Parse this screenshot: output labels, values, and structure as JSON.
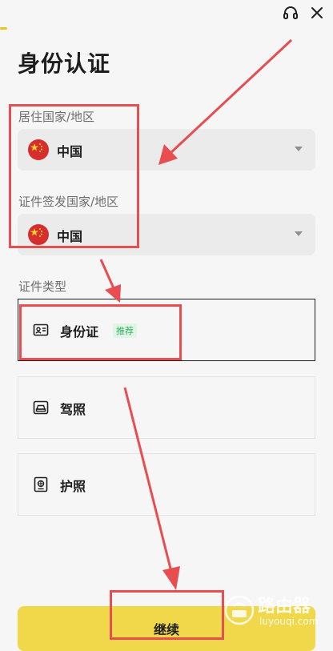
{
  "header": {
    "support_icon": "headset-icon",
    "close_icon": "close-icon"
  },
  "page": {
    "title": "身份认证"
  },
  "residence": {
    "label": "居住国家/地区",
    "value": "中国",
    "flag": "china-flag-icon"
  },
  "issuing": {
    "label": "证件签发国家/地区",
    "value": "中国",
    "flag": "china-flag-icon"
  },
  "document_type": {
    "label": "证件类型",
    "options": [
      {
        "label": "身份证",
        "badge": "推荐",
        "icon": "id-card-icon",
        "selected": true
      },
      {
        "label": "驾照",
        "icon": "car-license-icon",
        "selected": false
      },
      {
        "label": "护照",
        "icon": "passport-icon",
        "selected": false
      }
    ]
  },
  "continue_button": {
    "label": "继续"
  },
  "watermark": {
    "title": "路由器",
    "subtitle": "luyouqi.com"
  },
  "colors": {
    "accent": "#f0d84a",
    "annotation": "#e84d50",
    "badge_green": "#2db35a"
  }
}
